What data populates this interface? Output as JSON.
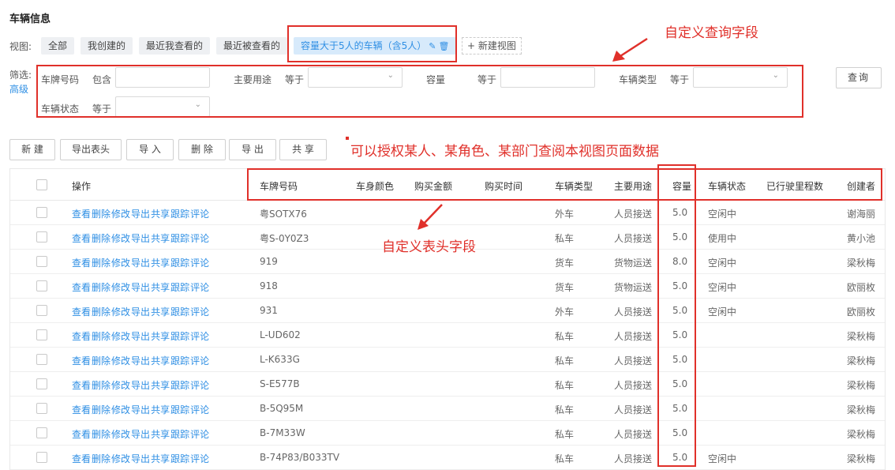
{
  "page_title": "车辆信息",
  "views": {
    "label": "视图:",
    "tabs": [
      {
        "label": "全部",
        "active": false
      },
      {
        "label": "我创建的",
        "active": false
      },
      {
        "label": "最近我查看的",
        "active": false
      },
      {
        "label": "最近被查看的",
        "active": false
      },
      {
        "label": "容量大于5人的车辆（含5人）",
        "active": true
      }
    ],
    "new_view": "+ 新建视图"
  },
  "filters": {
    "label": "筛选:",
    "advanced": "高级",
    "plate_label": "车牌号码",
    "plate_op": "包含",
    "plate_value": "",
    "purpose_label": "主要用途",
    "purpose_op": "等于",
    "purpose_value": "",
    "capacity_label": "容量",
    "capacity_op": "等于",
    "capacity_value": "",
    "type_label": "车辆类型",
    "type_op": "等于",
    "type_value": "",
    "status_label": "车辆状态",
    "status_op": "等于",
    "status_value": "",
    "query": "查询"
  },
  "toolbar": {
    "new": "新 建",
    "export_header": "导出表头",
    "import": "导 入",
    "delete": "删 除",
    "export": "导 出",
    "share": "共 享"
  },
  "annotations": {
    "query_fields": "自定义查询字段",
    "authorize": "可以授权某人、某角色、某部门查阅本视图页面数据",
    "header_fields": "自定义表头字段"
  },
  "table": {
    "headers": {
      "ops": "操作",
      "plate": "车牌号码",
      "color": "车身颜色",
      "price": "购买金额",
      "date": "购买时间",
      "type": "车辆类型",
      "purpose": "主要用途",
      "capacity": "容量",
      "status": "车辆状态",
      "mileage": "已行驶里程数",
      "creator": "创建者"
    },
    "row_ops": [
      "查看",
      "删除",
      "修改",
      "导出",
      "共享",
      "跟踪",
      "评论"
    ],
    "rows": [
      {
        "plate": "粤SOTX76",
        "type": "外车",
        "purpose": "人员接送",
        "capacity": "5.0",
        "status": "空闲中",
        "creator": "谢海丽"
      },
      {
        "plate": "粤S-0Y0Z3",
        "type": "私车",
        "purpose": "人员接送",
        "capacity": "5.0",
        "status": "使用中",
        "creator": "黄小池"
      },
      {
        "plate": "919",
        "type": "货车",
        "purpose": "货物运送",
        "capacity": "8.0",
        "status": "空闲中",
        "creator": "梁秋梅"
      },
      {
        "plate": "918",
        "type": "货车",
        "purpose": "货物运送",
        "capacity": "5.0",
        "status": "空闲中",
        "creator": "欧丽枚"
      },
      {
        "plate": "931",
        "type": "外车",
        "purpose": "人员接送",
        "capacity": "5.0",
        "status": "空闲中",
        "creator": "欧丽枚"
      },
      {
        "plate": "L-UD602",
        "type": "私车",
        "purpose": "人员接送",
        "capacity": "5.0",
        "status": "",
        "creator": "梁秋梅"
      },
      {
        "plate": "L-K633G",
        "type": "私车",
        "purpose": "人员接送",
        "capacity": "5.0",
        "status": "",
        "creator": "梁秋梅"
      },
      {
        "plate": "S-E577B",
        "type": "私车",
        "purpose": "人员接送",
        "capacity": "5.0",
        "status": "",
        "creator": "梁秋梅"
      },
      {
        "plate": "B-5Q95M",
        "type": "私车",
        "purpose": "人员接送",
        "capacity": "5.0",
        "status": "",
        "creator": "梁秋梅"
      },
      {
        "plate": "B-7M33W",
        "type": "私车",
        "purpose": "人员接送",
        "capacity": "5.0",
        "status": "",
        "creator": "梁秋梅"
      },
      {
        "plate": "B-74P83/B033TV",
        "type": "私车",
        "purpose": "人员接送",
        "capacity": "5.0",
        "status": "空闲中",
        "creator": "梁秋梅"
      }
    ]
  },
  "colors": {
    "accent": "#2f8fe4",
    "annotation": "#e0302a"
  }
}
